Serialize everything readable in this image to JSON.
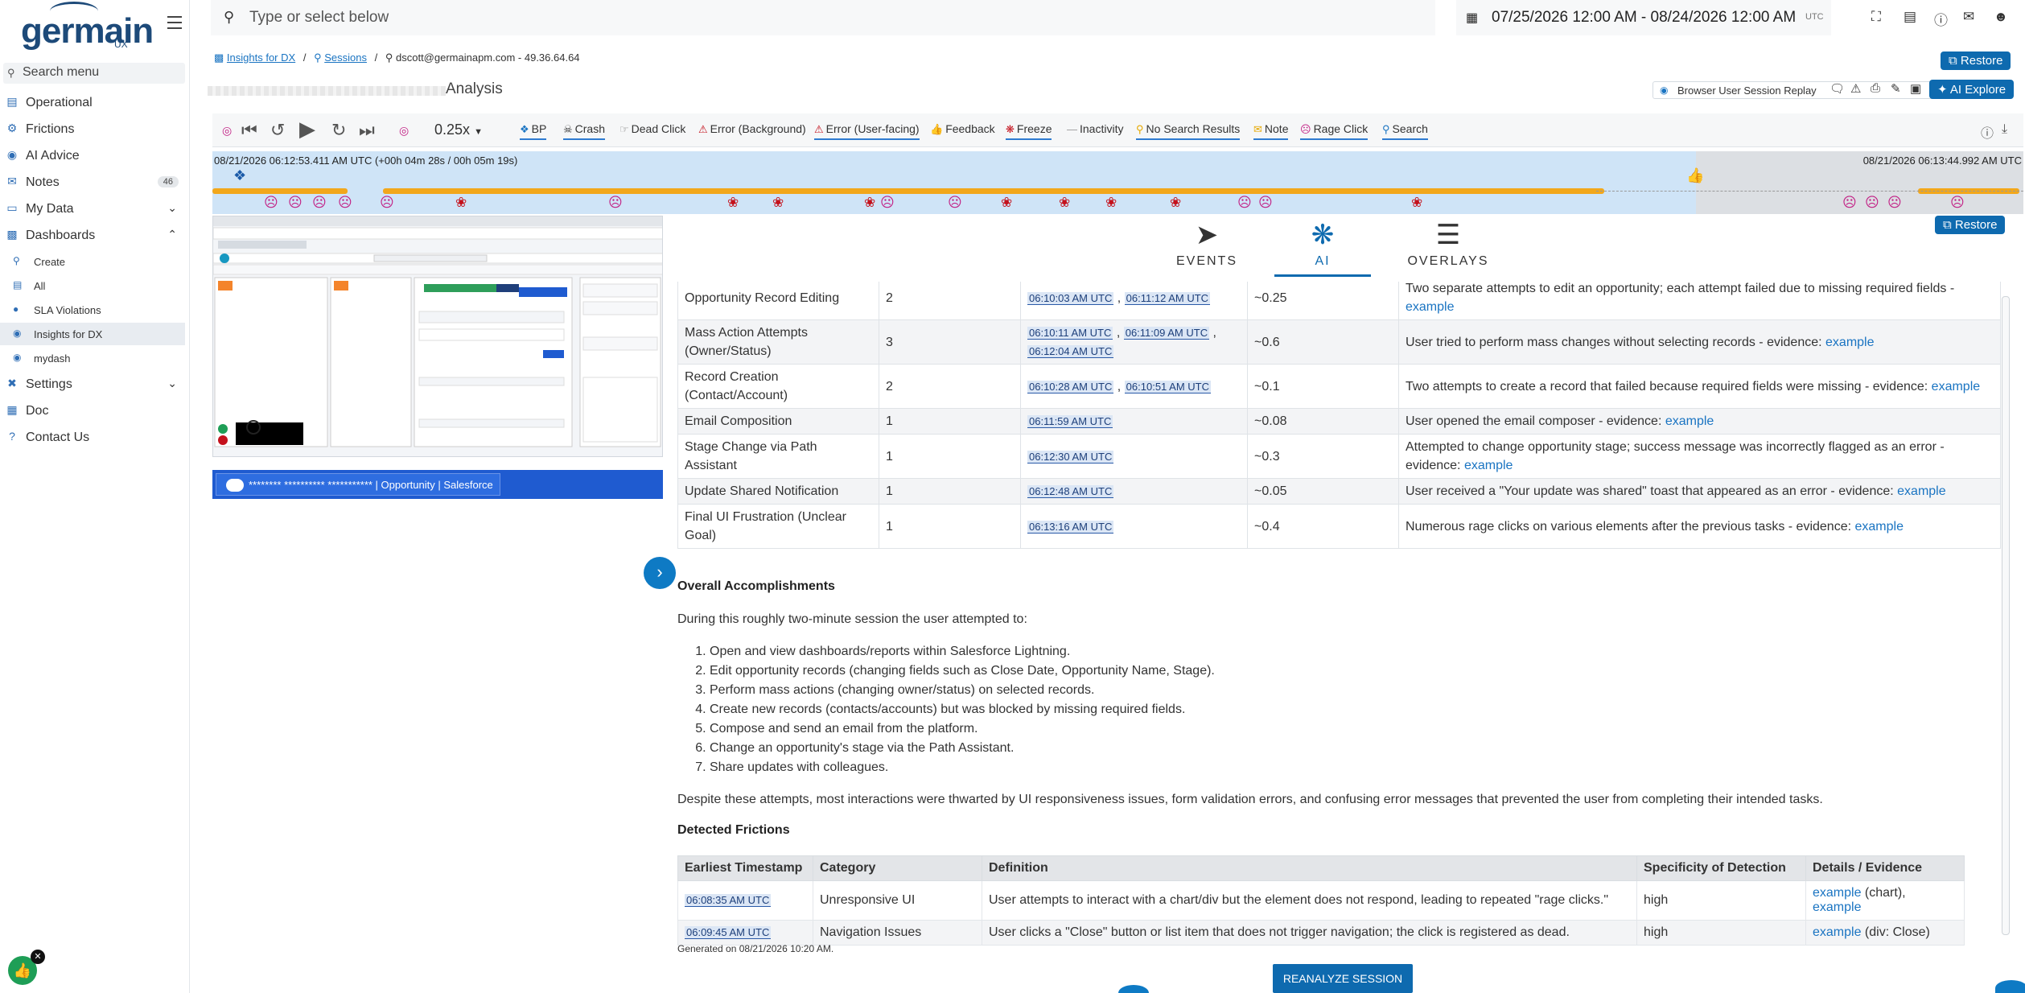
{
  "app": {
    "logo_text": "germain",
    "logo_sub": "UX"
  },
  "sidebar": {
    "search_placeholder": "Search menu",
    "items": [
      {
        "label": "Operational",
        "icon": "chart-icon"
      },
      {
        "label": "Frictions",
        "icon": "frictions-icon"
      },
      {
        "label": "AI Advice",
        "icon": "ai-icon"
      },
      {
        "label": "Notes",
        "icon": "notes-icon",
        "count": "46"
      },
      {
        "label": "My Data",
        "icon": "monitor-icon"
      },
      {
        "label": "Dashboards",
        "icon": "dashboard-icon"
      }
    ],
    "dash_sub": [
      {
        "label": "Create",
        "icon": "search-icon"
      },
      {
        "label": "All",
        "icon": "list-icon"
      },
      {
        "label": "SLA Violations",
        "icon": "alert-icon"
      },
      {
        "label": "Insights for DX",
        "icon": "dx-icon"
      },
      {
        "label": "mydash",
        "icon": "mydash-icon"
      }
    ],
    "bottom": [
      {
        "label": "Settings",
        "icon": "gear-icon"
      },
      {
        "label": "Doc",
        "icon": "doc-icon"
      },
      {
        "label": "Contact Us",
        "icon": "help-icon"
      }
    ]
  },
  "topbar": {
    "search_placeholder": "Type or select below",
    "date_range": "07/25/2026 12:00 AM - 08/24/2026 12:00 AM",
    "timezone": "UTC"
  },
  "breadcrumb": {
    "items": [
      "Insights for DX",
      "Sessions"
    ],
    "current": "dscott@germainapm.com - 49.36.64.64"
  },
  "header": {
    "title_suffix": "Analysis",
    "restore_label": "Restore",
    "replay_label": "Browser User Session Replay",
    "ai_explore_label": "AI Explore"
  },
  "player": {
    "speed": "0.25x",
    "filters": [
      {
        "label": "BP",
        "on": true
      },
      {
        "label": "Crash",
        "on": true
      },
      {
        "label": "Dead Click",
        "on": false
      },
      {
        "label": "Error (Background)",
        "on": false
      },
      {
        "label": "Error (User-facing)",
        "on": true
      },
      {
        "label": "Feedback",
        "on": false
      },
      {
        "label": "Freeze",
        "on": true
      },
      {
        "label": "Inactivity",
        "on": false
      },
      {
        "label": "No Search Results",
        "on": true
      },
      {
        "label": "Note",
        "on": true
      },
      {
        "label": "Rage Click",
        "on": true
      },
      {
        "label": "Search",
        "on": true
      }
    ]
  },
  "timeline": {
    "start": "08/21/2026 06:12:53.411 AM UTC (+00h 04m 28s / 00h 05m 19s)",
    "end": "08/21/2026 06:13:44.992 AM UTC"
  },
  "replay": {
    "caption": "******** ********** *********** | Opportunity | Salesforce"
  },
  "tabs": [
    "EVENTS",
    "AI",
    "OVERLAYS"
  ],
  "restore2_label": "Restore",
  "frictions_table": [
    {
      "task": "Opportunity Record Editing",
      "count": "2",
      "times": [
        "06:10:03 AM UTC",
        "06:11:12 AM UTC"
      ],
      "score": "~0.25",
      "desc": "Two separate attempts to edit an opportunity; each attempt failed due to missing required fields -",
      "evidence": "example"
    },
    {
      "task": "Mass Action Attempts (Owner/Status)",
      "count": "3",
      "times": [
        "06:10:11 AM UTC",
        "06:11:09 AM UTC",
        "06:12:04 AM UTC"
      ],
      "score": "~0.6",
      "desc": "User tried to perform mass changes without selecting records - evidence:",
      "evidence": "example"
    },
    {
      "task": "Record Creation (Contact/Account)",
      "count": "2",
      "times": [
        "06:10:28 AM UTC",
        "06:10:51 AM UTC"
      ],
      "score": "~0.1",
      "desc": "Two attempts to create a record that failed because required fields were missing - evidence:",
      "evidence": "example"
    },
    {
      "task": "Email Composition",
      "count": "1",
      "times": [
        "06:11:59 AM UTC"
      ],
      "score": "~0.08",
      "desc": "User opened the email composer - evidence:",
      "evidence": "example"
    },
    {
      "task": "Stage Change via Path Assistant",
      "count": "1",
      "times": [
        "06:12:30 AM UTC"
      ],
      "score": "~0.3",
      "desc": "Attempted to change opportunity stage; success message was incorrectly flagged as an error - evidence:",
      "evidence": "example"
    },
    {
      "task": "Update Shared Notification",
      "count": "1",
      "times": [
        "06:12:48 AM UTC"
      ],
      "score": "~0.05",
      "desc": "User received a \"Your update was shared\" toast that appeared as an error - evidence:",
      "evidence": "example"
    },
    {
      "task": "Final UI Frustration (Unclear Goal)",
      "count": "1",
      "times": [
        "06:13:16 AM UTC"
      ],
      "score": "~0.4",
      "desc": "Numerous rage clicks on various elements after the previous tasks - evidence:",
      "evidence": "example"
    }
  ],
  "accomplishments": {
    "heading": "Overall Accomplishments",
    "intro": "During this roughly two-minute session the user attempted to:",
    "items": [
      "Open and view dashboards/reports within Salesforce Lightning.",
      "Edit opportunity records (changing fields such as Close Date, Opportunity Name, Stage).",
      "Perform mass actions (changing owner/status) on selected records.",
      "Create new records (contacts/accounts) but was blocked by missing required fields.",
      "Compose and send an email from the platform.",
      "Change an opportunity's stage via the Path Assistant.",
      "Share updates with colleagues."
    ],
    "summary": "Despite these attempts, most interactions were thwarted by UI responsiveness issues, form validation errors, and confusing error messages that prevented the user from completing their intended tasks."
  },
  "detected": {
    "heading": "Detected Frictions",
    "columns": [
      "Earliest Timestamp",
      "Category",
      "Definition",
      "Specificity of Detection",
      "Details / Evidence"
    ],
    "rows": [
      {
        "ts": "06:08:35 AM UTC",
        "category": "Unresponsive UI",
        "definition": "User attempts to interact with a chart/div but the element does not respond, leading to repeated \"rage clicks.\"",
        "specificity": "high",
        "ev1": "example",
        "ev1_note": " (chart), ",
        "ev2": "example",
        "ev2_note": ""
      },
      {
        "ts": "06:09:45 AM UTC",
        "category": "Navigation Issues",
        "definition": "User clicks a \"Close\" button or list item that does not trigger navigation; the click is registered as dead.",
        "specificity": "high",
        "ev1": "example",
        "ev1_note": " (div: Close)",
        "ev2": "",
        "ev2_note": ""
      }
    ]
  },
  "generated": "Generated on 08/21/2026 10:20 AM.",
  "reanalyze_label": "REANALYZE SESSION",
  "colors": {
    "accent": "#0e6aaf",
    "timeline": "#cfe4f7",
    "rage": "#c21e84",
    "crash": "#c4111c",
    "bp": "#f2a71b"
  }
}
